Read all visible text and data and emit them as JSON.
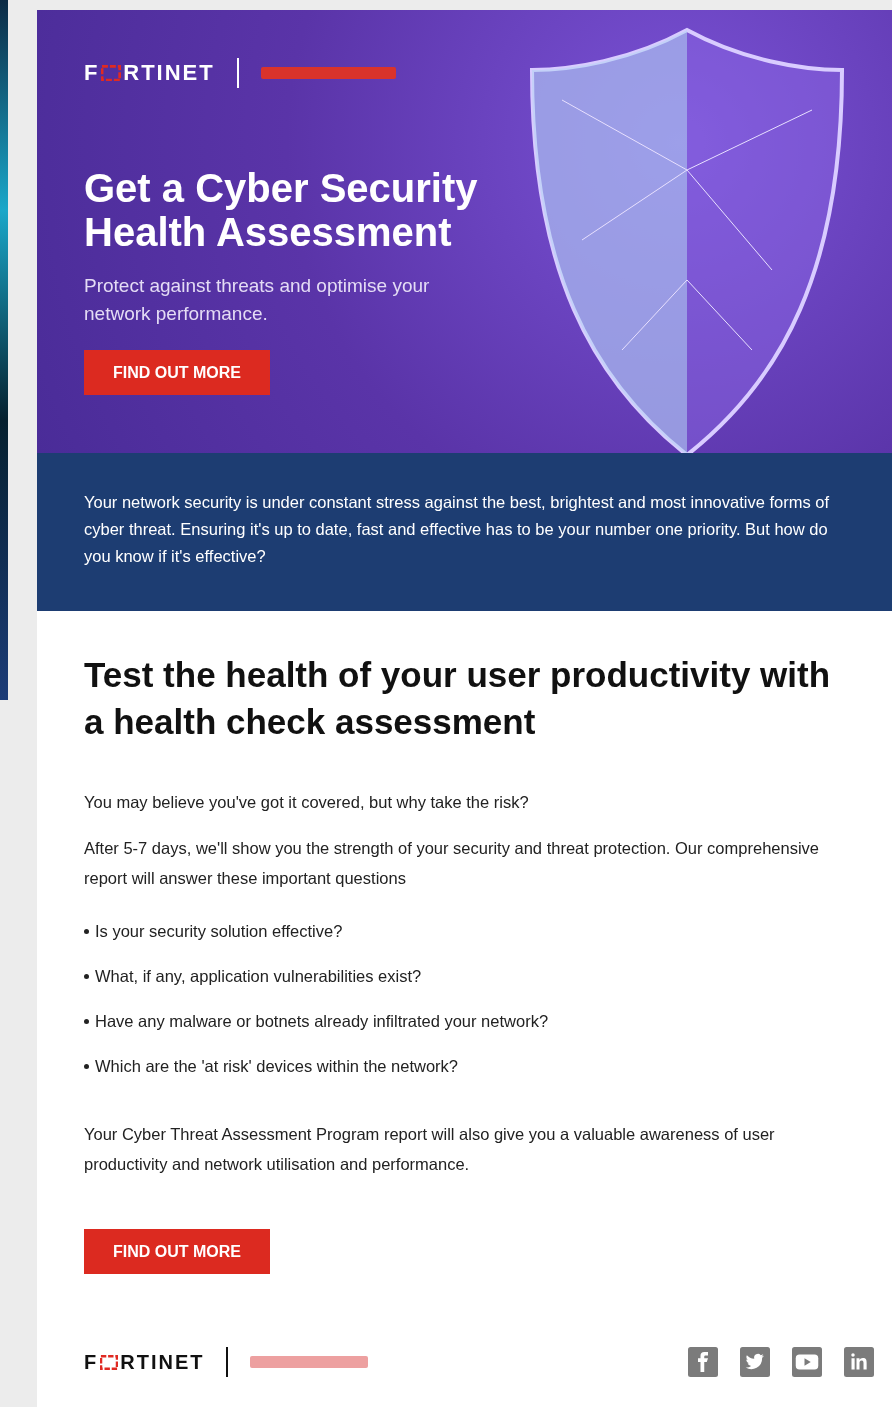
{
  "hero": {
    "logo": {
      "before": "F",
      "after": "RTINET"
    },
    "title": "Get a Cyber Security Health Assessment",
    "subtitle": "Protect against threats and optimise your network performance.",
    "button": "FIND OUT MORE"
  },
  "intro": "Your network security is under constant stress against the best, brightest and most innovative forms of cyber threat. Ensuring it's up to date, fast and effective has to be your number one priority. But how do you know if it's effective?",
  "body": {
    "heading": "Test the health of your user productivity with a health check assessment",
    "paragraphs": [
      "You may believe you've got it covered, but why take the risk?",
      "After 5-7 days, we'll show you the strength of your security and threat protection. Our comprehensive report will answer these important questions"
    ],
    "bullets": [
      "Is your security solution effective?",
      "What, if any, application vulnerabilities exist?",
      "Have any malware or botnets already infiltrated your network?",
      "Which are the 'at risk' devices within the network?"
    ],
    "closing": "Your Cyber Threat Assessment Program report will also give you a valuable awareness of user productivity and network utilisation and performance.",
    "button": "FIND OUT MORE"
  },
  "footer": {
    "logo": {
      "before": "F",
      "after": "RTINET"
    },
    "social": [
      {
        "kind": "facebook"
      },
      {
        "kind": "twitter"
      },
      {
        "kind": "youtube"
      },
      {
        "kind": "linkedin"
      }
    ]
  }
}
